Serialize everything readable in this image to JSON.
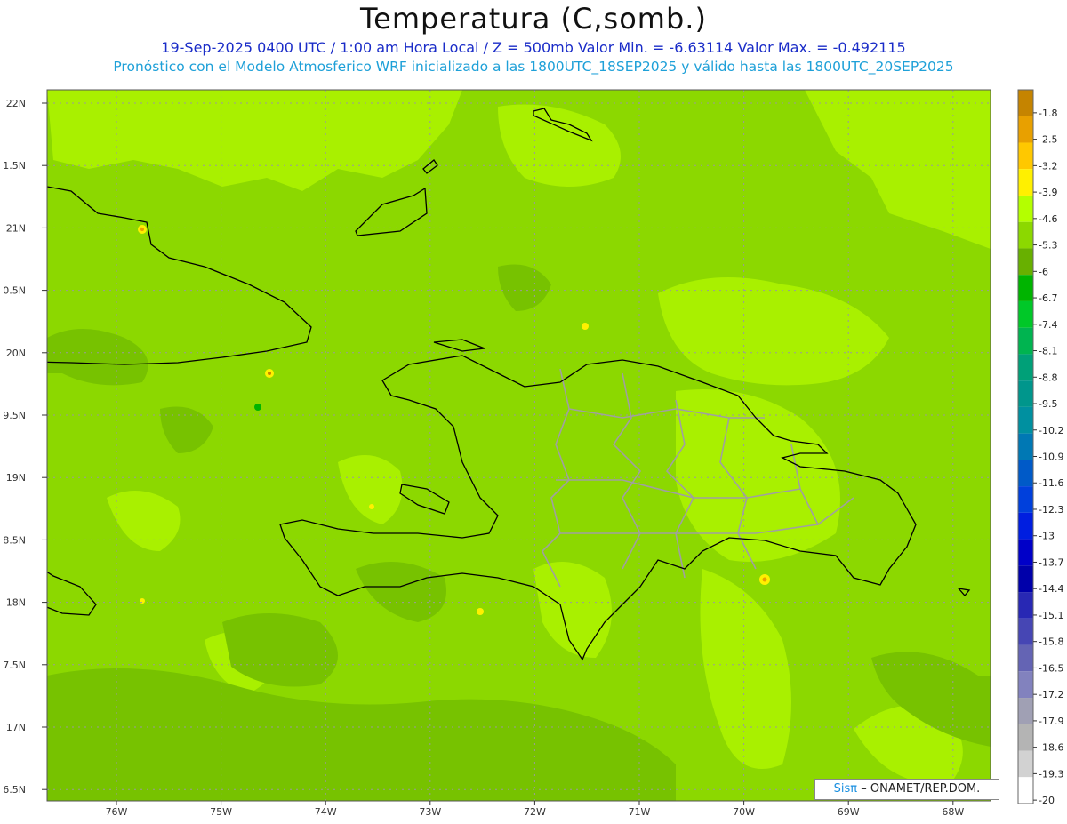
{
  "header": {
    "title": "Temperatura (C,somb.)",
    "line1": "19-Sep-2025  0400 UTC / 1:00 am Hora Local / Z = 500mb  Valor Min. = -6.63114  Valor Max. = -0.492115",
    "line2": "Pronóstico con el Modelo Atmosferico WRF inicializado a las 1800UTC_18SEP2025 y válido hasta las  1800UTC_20SEP2025"
  },
  "credit": {
    "brand": "Sisπ",
    "org": "– ONAMET/REP.DOM."
  },
  "axes": {
    "x_labels": [
      "76W",
      "75W",
      "74W",
      "73W",
      "72W",
      "71W",
      "70W",
      "69W",
      "68W"
    ],
    "y_labels": [
      "22N",
      "1.5N",
      "21N",
      "0.5N",
      "20N",
      "9.5N",
      "19N",
      "8.5N",
      "18N",
      "7.5N",
      "17N",
      "6.5N"
    ]
  },
  "colorbar": {
    "labels": [
      "-1.8",
      "-2.5",
      "-3.2",
      "-3.9",
      "-4.6",
      "-5.3",
      "-6",
      "-6.7",
      "-7.4",
      "-8.1",
      "-8.8",
      "-9.5",
      "-10.2",
      "-10.9",
      "-11.6",
      "-12.3",
      "-13",
      "-13.7",
      "-14.4",
      "-15.1",
      "-15.8",
      "-16.5",
      "-17.2",
      "-17.9",
      "-18.6",
      "-19.3",
      "-20"
    ],
    "colors": [
      "#c58400",
      "#e8a000",
      "#ffc800",
      "#fff000",
      "#b4ff00",
      "#8cd800",
      "#68b000",
      "#00b400",
      "#00c828",
      "#00b450",
      "#00a078",
      "#00968c",
      "#0090a0",
      "#0078b4",
      "#005ac8",
      "#0040dc",
      "#001ee0",
      "#0000c8",
      "#0000aa",
      "#2828b4",
      "#4646b4",
      "#6464b4",
      "#8282be",
      "#a0a0b4",
      "#b4b4b4",
      "#d2d2d2",
      "#ffffff"
    ]
  },
  "colors": {
    "base_field": "#8cd800",
    "light_field": "#a9f000",
    "dark_field": "#76c000",
    "coast": "#000000",
    "borders": "#a0a0a0"
  }
}
